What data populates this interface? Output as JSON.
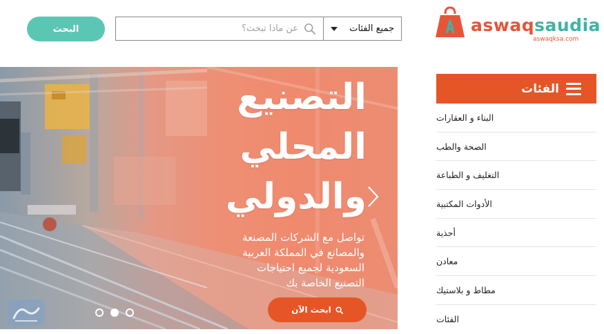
{
  "header": {
    "search_button_label": "البحث",
    "search_placeholder": "عن ماذا تبحث؟",
    "category_select_value": "جميع الفئات"
  },
  "logo": {
    "text_part1": "aswaq",
    "text_part2": "saudia",
    "url_text": "aswaqksa.com"
  },
  "banner": {
    "headline_lines": [
      "التصنيع",
      "المحلي",
      "والدولي"
    ],
    "subtext_lines": [
      "تواصل مع الشركات المصنعة",
      "والمصانع في المملكة العربية",
      "السعودية لجميع احتياجات",
      "التصنيع الخاصة بك"
    ],
    "cta_label": "ابحث الآن",
    "slide_count": 3,
    "active_slide": 2
  },
  "sidebar": {
    "title": "الفئات",
    "items": [
      {
        "label": "البناء و العقارات"
      },
      {
        "label": "الصحة والطب"
      },
      {
        "label": "التغليف و الطباعة"
      },
      {
        "label": "الأدوات المكتبية"
      },
      {
        "label": "أحذية"
      },
      {
        "label": "معادن"
      },
      {
        "label": "مطاط و بلاستيك"
      },
      {
        "label": "الفئات"
      }
    ]
  },
  "colors": {
    "brand_orange": "#e65526",
    "brand_teal": "#5cc6b4"
  }
}
